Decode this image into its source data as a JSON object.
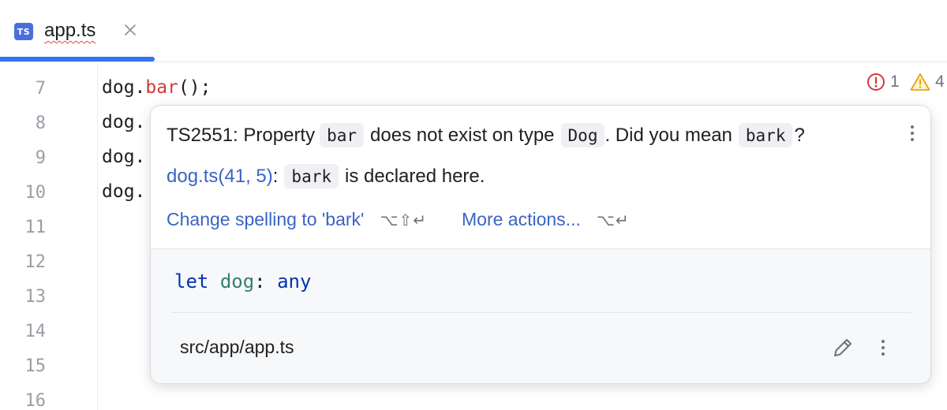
{
  "tab": {
    "icon_text": "TS",
    "label": "app.ts",
    "close_glyph": "×",
    "accent_color": "#3574f0",
    "icon_color": "#4a6fdc"
  },
  "editor": {
    "line_numbers": [
      "7",
      "8",
      "9",
      "10",
      "11",
      "12",
      "13",
      "14",
      "15",
      "16"
    ],
    "lines": [
      {
        "prefix": "dog.",
        "error_token": "bar",
        "suffix": "();"
      },
      {
        "prefix": "dog."
      },
      {
        "prefix": "dog."
      },
      {
        "prefix": "dog."
      }
    ],
    "inspections": {
      "errors": "1",
      "warnings": "4",
      "error_color": "#d13b3b",
      "warning_color": "#e5a50a"
    }
  },
  "popup": {
    "message": {
      "code": "TS2551: Property",
      "prop_chip": "bar",
      "mid_text": "does not exist on type",
      "type_chip": "Dog",
      "suggest_text": ". Did you mean",
      "suggest_chip": "bark",
      "end_text": "?"
    },
    "declared": {
      "link": "dog.ts(41, 5)",
      "colon": ":",
      "chip": "bark",
      "text": "is declared here."
    },
    "actions": [
      {
        "label": "Change spelling to 'bark'",
        "shortcut": "⌥⇧↵"
      },
      {
        "label": "More actions...",
        "shortcut": "⌥↵"
      }
    ],
    "declaration": {
      "keyword": "let",
      "identifier": "dog",
      "colon": ":",
      "type": "any"
    },
    "file_path": "src/app/app.ts"
  }
}
